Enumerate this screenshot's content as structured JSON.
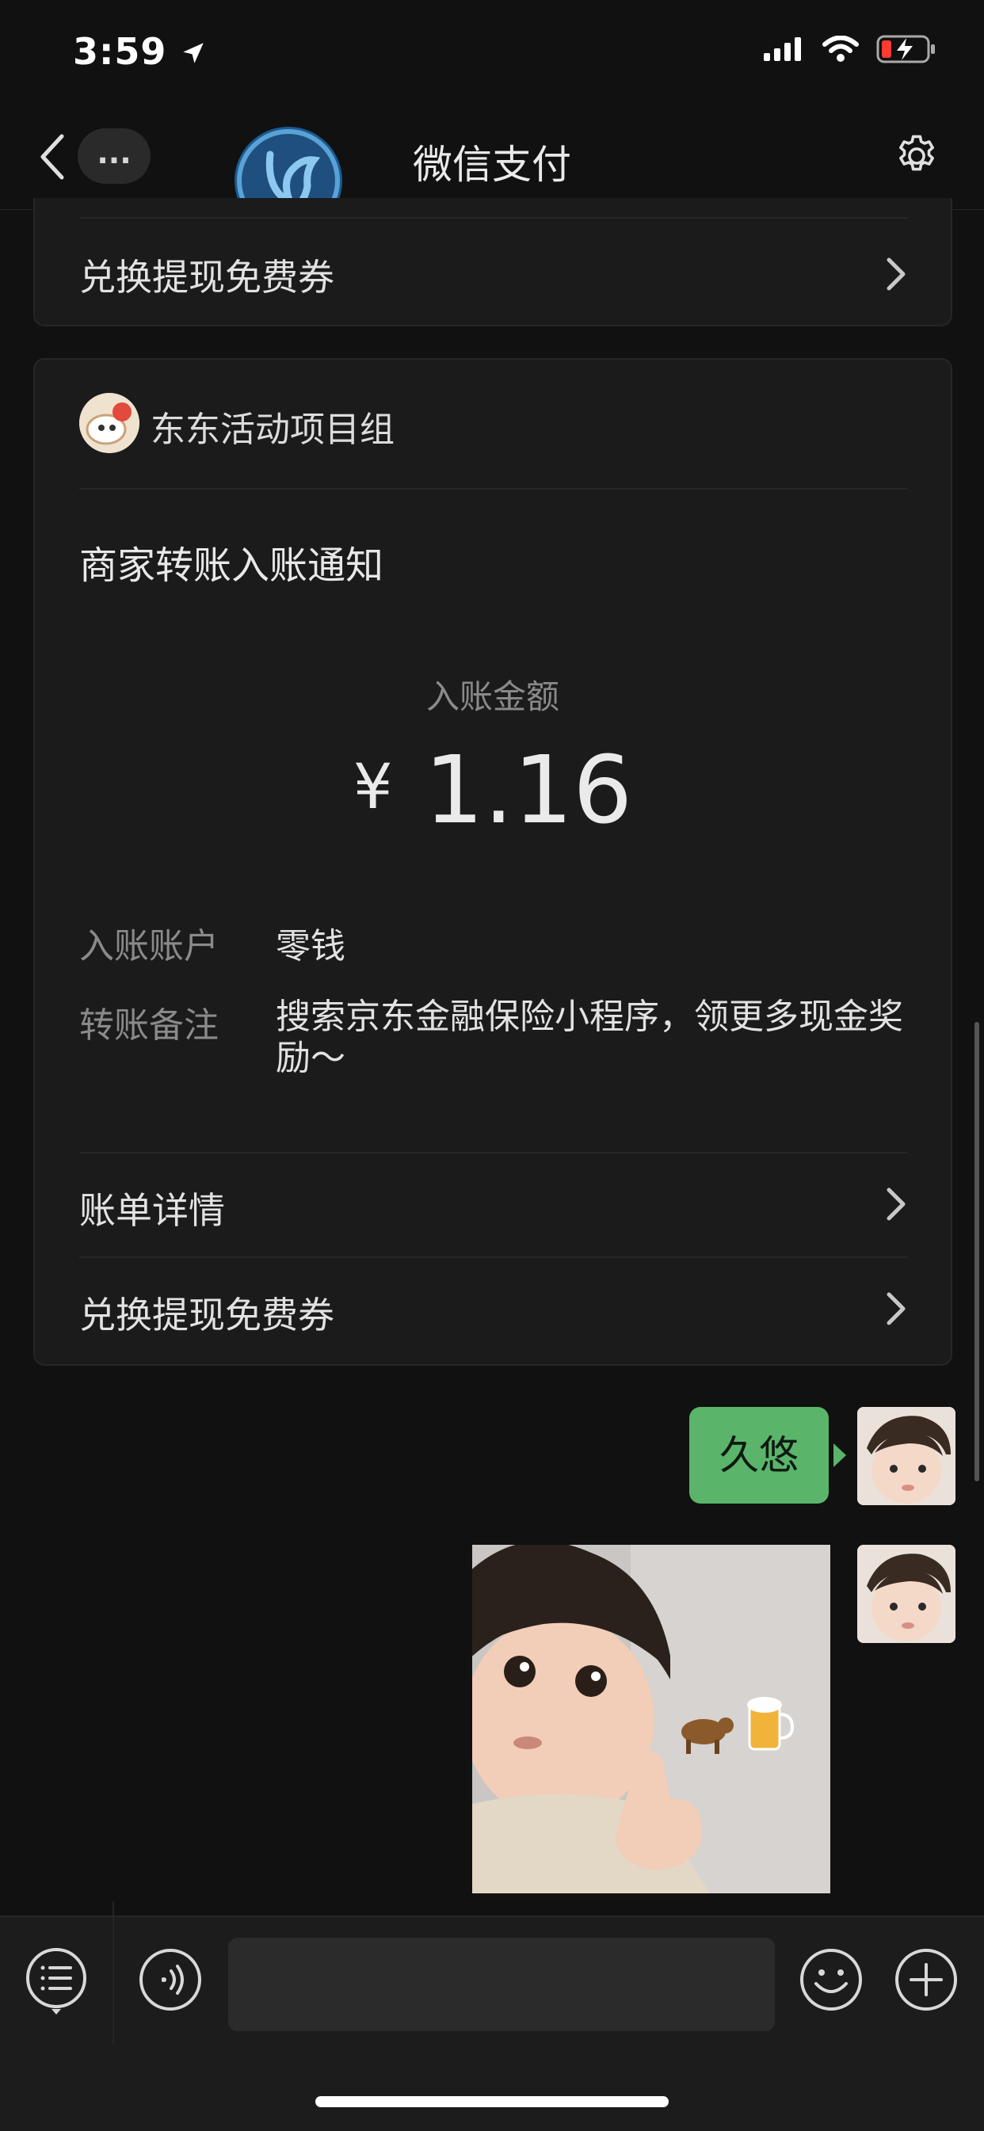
{
  "status_bar": {
    "time": "3:59"
  },
  "nav": {
    "title": "微信支付",
    "more": "..."
  },
  "top_card": {
    "redeem_label": "兑换提现免费券"
  },
  "notice_card": {
    "sender": "东东活动项目组",
    "title": "商家转账入账通知",
    "amount_label": "入账金额",
    "currency": "¥",
    "amount": "1.16",
    "account_label": "入账账户",
    "account_value": "零钱",
    "remark_label": "转账备注",
    "remark_value": "搜索京东金融保险小程序，领更多现金奖励～",
    "bill_details": "账单详情",
    "redeem_label": "兑换提现免费券"
  },
  "chat": {
    "message_text": "久悠"
  },
  "colors": {
    "background": "#111111",
    "card": "#1b1b1b",
    "bubble_green": "#5ab56b"
  }
}
